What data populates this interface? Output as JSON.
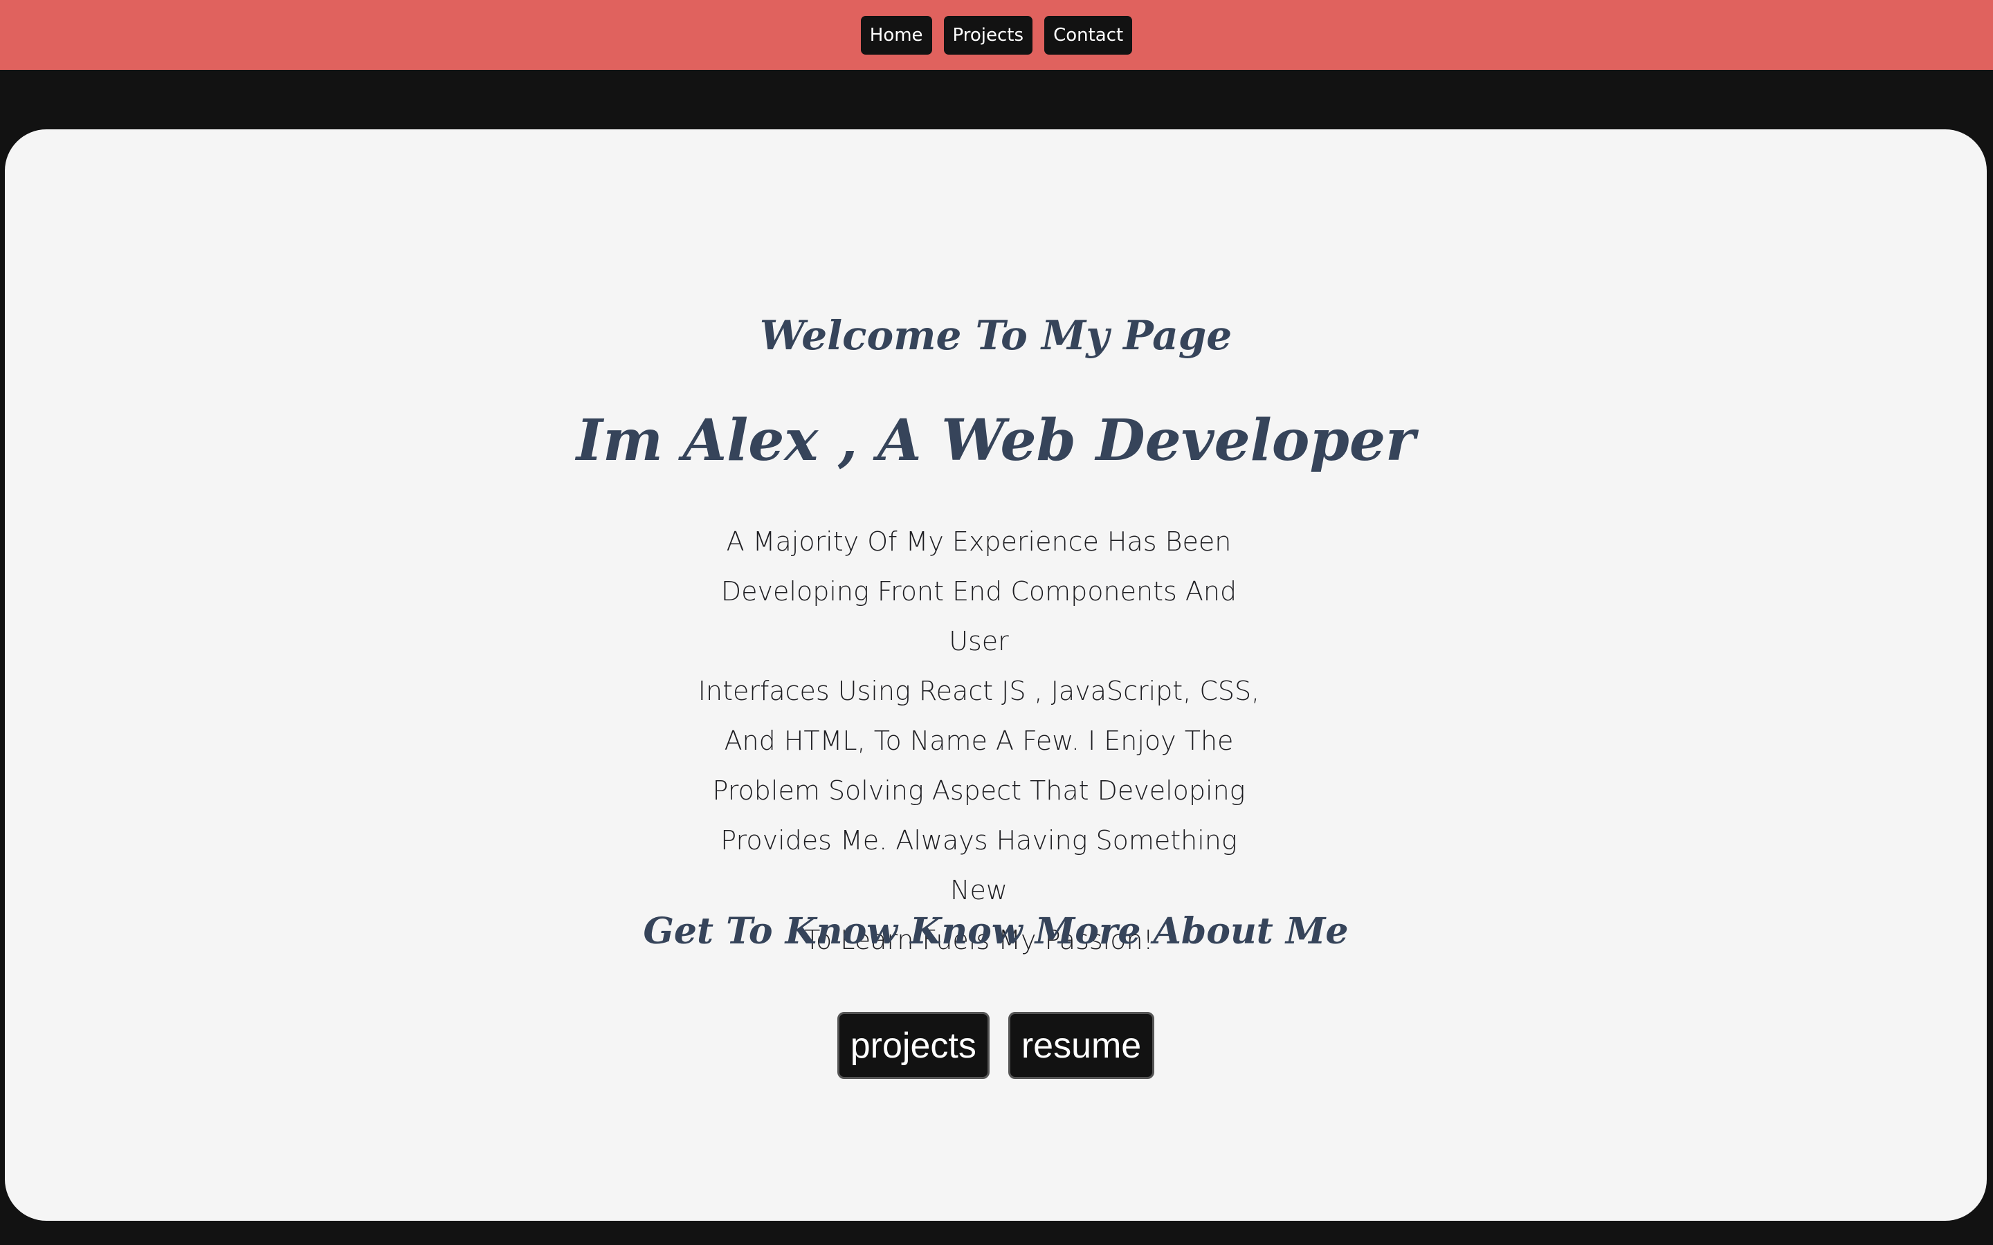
{
  "nav": {
    "items": [
      {
        "label": "Home"
      },
      {
        "label": "Projects"
      },
      {
        "label": "Contact"
      }
    ]
  },
  "hero": {
    "welcome": "Welcome To My Page",
    "headline": "Im Alex , A Web Developer",
    "about_lines": [
      "A Majority Of My Experience Has Been",
      "Developing Front End Components And User",
      "Interfaces Using React JS , JavaScript, CSS,",
      "And HTML, To Name A Few. I Enjoy The",
      "Problem Solving Aspect That Developing",
      "Provides Me. Always Having Something New",
      "To Learn Fuels My Passion!"
    ],
    "more_heading": "Get To Know Know More About Me",
    "buttons": [
      {
        "label": "projects"
      },
      {
        "label": "resume"
      }
    ]
  },
  "colors": {
    "topbar": "#e0625e",
    "page_background": "#121212",
    "card_background": "#f5f5f5",
    "heading_text": "#36445a",
    "body_text": "#1e1e22",
    "button_background": "#121212",
    "button_text": "#ffffff"
  }
}
